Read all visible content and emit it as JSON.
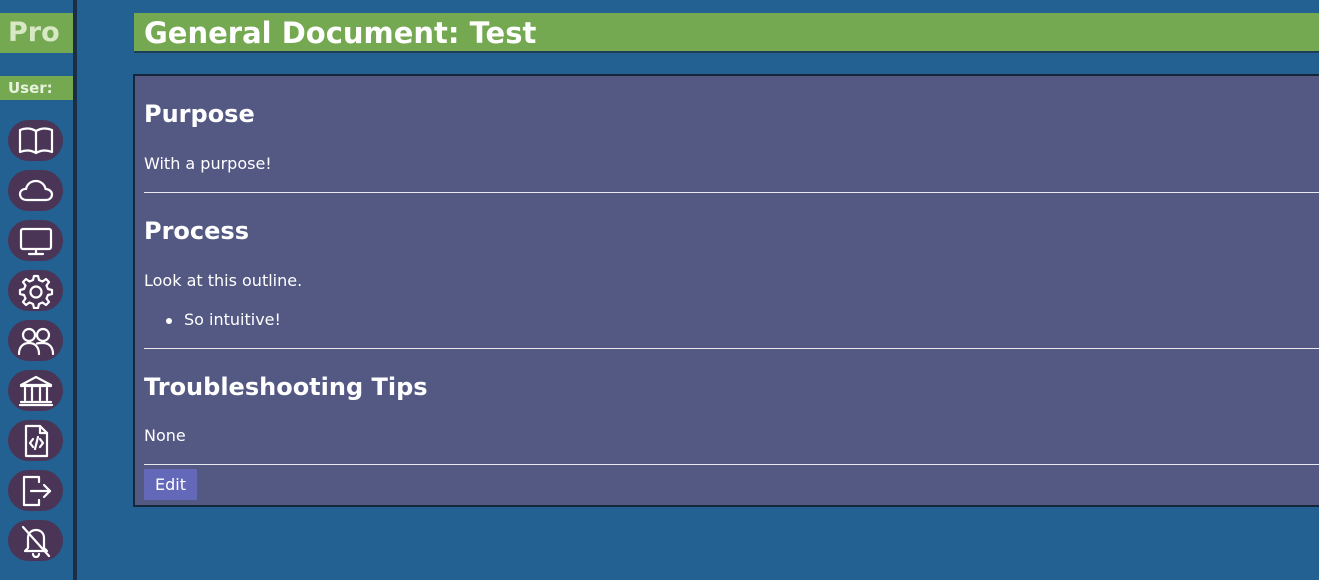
{
  "sidebar": {
    "brand": "Pro",
    "user_label": "User:",
    "nav_icons": [
      "book-icon",
      "cloud-icon",
      "monitor-icon",
      "gear-icon",
      "users-icon",
      "bank-icon",
      "code-file-icon",
      "logout-icon",
      "bell-off-icon"
    ]
  },
  "document": {
    "title": "General Document: Test",
    "sections": [
      {
        "heading": "Purpose",
        "text": "With a purpose!"
      },
      {
        "heading": "Process",
        "text": "Look at this outline.",
        "items": [
          "So intuitive!"
        ]
      },
      {
        "heading": "Troubleshooting Tips",
        "text": "None"
      }
    ],
    "edit_label": "Edit"
  },
  "colors": {
    "page_background": "#226191",
    "accent_green": "#74a952",
    "panel": "#545984",
    "nav_button": "#4a3557",
    "edit_button": "#6368b8"
  }
}
